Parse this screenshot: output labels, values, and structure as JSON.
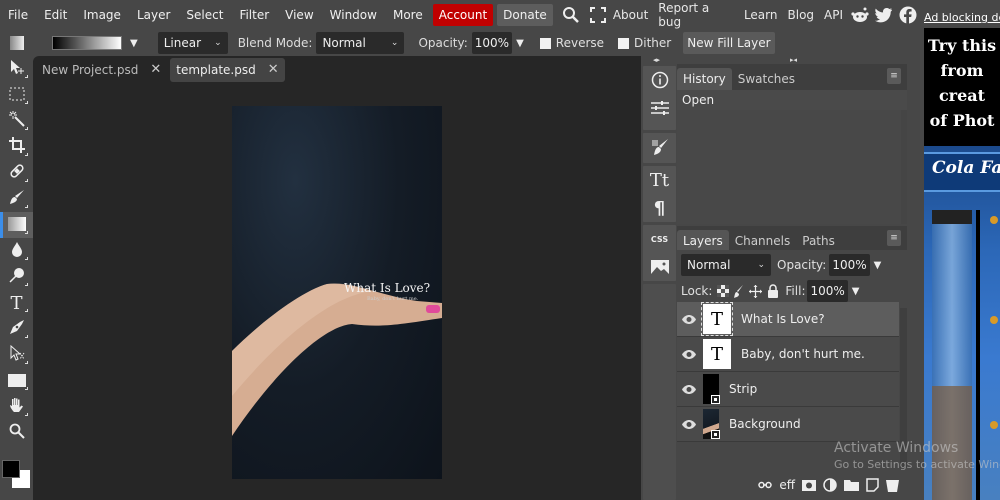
{
  "menubar": {
    "items": [
      "File",
      "Edit",
      "Image",
      "Layer",
      "Select",
      "Filter",
      "View",
      "Window",
      "More"
    ],
    "account_label": "Account",
    "donate_label": "Donate",
    "links": [
      "About",
      "Report a bug",
      "Learn",
      "Blog",
      "API"
    ],
    "social": [
      "reddit-icon",
      "twitter-icon",
      "facebook-icon"
    ]
  },
  "options": {
    "gradient_type": "Linear",
    "blend_mode_label": "Blend Mode:",
    "blend_mode": "Normal",
    "opacity_label": "Opacity:",
    "opacity": "100%",
    "reverse_label": "Reverse",
    "dither_label": "Dither",
    "new_fill_layer_label": "New Fill Layer"
  },
  "tools": [
    "move",
    "marquee",
    "magic-wand",
    "crop",
    "healing",
    "brush",
    "gradient",
    "blur",
    "dodge",
    "type",
    "pen",
    "path-select",
    "shape",
    "hand",
    "zoom"
  ],
  "active_tool": "gradient",
  "colors": {
    "foreground": "#000000",
    "background": "#ffffff",
    "accent": "#3b8eea",
    "guide_arrow": "#00d8e8"
  },
  "documents": {
    "tabs": [
      {
        "label": "New Project.psd",
        "active": false
      },
      {
        "label": "template.psd",
        "active": true
      }
    ]
  },
  "canvas": {
    "title_text": "What Is Love?",
    "subtitle_text": "Baby, don't hurt me."
  },
  "history_panel": {
    "tabs": [
      "History",
      "Swatches"
    ],
    "items": [
      "Open"
    ]
  },
  "layers_panel": {
    "tabs": [
      "Layers",
      "Channels",
      "Paths"
    ],
    "blend_mode": "Normal",
    "opacity_label": "Opacity:",
    "opacity": "100%",
    "lock_label": "Lock:",
    "fill_label": "Fill:",
    "fill": "100%",
    "layers": [
      {
        "name": "What Is Love?",
        "type": "text",
        "selected": true,
        "visible": true
      },
      {
        "name": "Baby, don't hurt me.",
        "type": "text",
        "selected": false,
        "visible": true
      },
      {
        "name": "Strip",
        "type": "smart",
        "selected": false,
        "visible": true
      },
      {
        "name": "Background",
        "type": "smart",
        "selected": false,
        "visible": true
      }
    ]
  },
  "panel_strip": {
    "css_label": "CSS"
  },
  "ad": {
    "link_text": "Ad blocking de",
    "headline_lines": [
      "Try this",
      "from",
      "creat",
      "of Phot"
    ],
    "game_title": "Cola Fa"
  },
  "watermark": {
    "line1": "Activate Windows",
    "line2": "Go to Settings to activate Windows."
  }
}
